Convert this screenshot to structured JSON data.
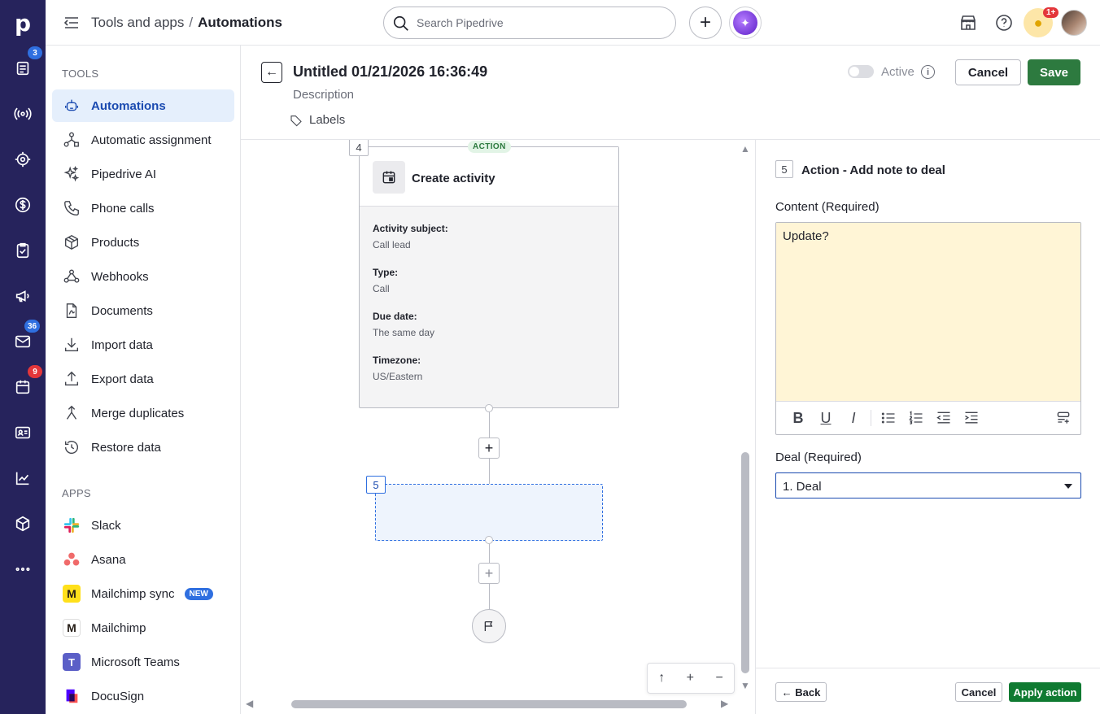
{
  "rail": {
    "logo": "p",
    "badges": {
      "leads": "3",
      "mail": "36",
      "calendar": "9"
    }
  },
  "topbar": {
    "crumb_parent": "Tools and apps",
    "crumb_sep": "/",
    "crumb_current": "Automations",
    "search_placeholder": "Search Pipedrive",
    "notifications_badge": "1+"
  },
  "sidebar": {
    "tools_heading": "TOOLS",
    "tools": [
      {
        "label": "Automations",
        "icon": "robot-icon",
        "active": true
      },
      {
        "label": "Automatic assignment",
        "icon": "assignment-icon"
      },
      {
        "label": "Pipedrive AI",
        "icon": "sparkle-icon"
      },
      {
        "label": "Phone calls",
        "icon": "phone-icon"
      },
      {
        "label": "Products",
        "icon": "box-icon"
      },
      {
        "label": "Webhooks",
        "icon": "webhook-icon"
      },
      {
        "label": "Documents",
        "icon": "document-icon"
      },
      {
        "label": "Import data",
        "icon": "import-icon"
      },
      {
        "label": "Export data",
        "icon": "export-icon"
      },
      {
        "label": "Merge duplicates",
        "icon": "merge-icon"
      },
      {
        "label": "Restore data",
        "icon": "restore-icon"
      }
    ],
    "apps_heading": "APPS",
    "apps": [
      {
        "label": "Slack",
        "icon": "slack-icon"
      },
      {
        "label": "Asana",
        "icon": "asana-icon"
      },
      {
        "label": "Mailchimp sync",
        "icon": "mailchimp-icon",
        "badge": "NEW"
      },
      {
        "label": "Mailchimp",
        "icon": "mailchimp-icon"
      },
      {
        "label": "Microsoft Teams",
        "icon": "teams-icon"
      },
      {
        "label": "DocuSign",
        "icon": "docusign-icon"
      }
    ]
  },
  "editor": {
    "title": "Untitled 01/21/2026 16:36:49",
    "description_placeholder": "Description",
    "labels": "Labels",
    "active_label": "Active",
    "cancel": "Cancel",
    "save": "Save"
  },
  "canvas": {
    "step4": {
      "number": "4",
      "tag": "ACTION",
      "title": "Create activity",
      "fields": [
        {
          "label": "Activity subject:",
          "value": "Call lead"
        },
        {
          "label": "Type:",
          "value": "Call"
        },
        {
          "label": "Due date:",
          "value": "The same day"
        },
        {
          "label": "Timezone:",
          "value": "US/Eastern"
        }
      ]
    },
    "step5": {
      "number": "5"
    },
    "zoom": {
      "reset": "↑",
      "in": "+",
      "out": "−"
    }
  },
  "panel": {
    "step_number": "5",
    "title": "Action - Add note to deal",
    "content_label": "Content (Required)",
    "content_value": "Update?",
    "deal_label": "Deal (Required)",
    "deal_value": "1. Deal",
    "back": "Back",
    "cancel": "Cancel",
    "apply": "Apply action"
  },
  "colors": {
    "rail": "#26235c",
    "accent_blue": "#2f6fe0",
    "save_green": "#2d7a3f",
    "note_yellow": "#fff5d6"
  }
}
